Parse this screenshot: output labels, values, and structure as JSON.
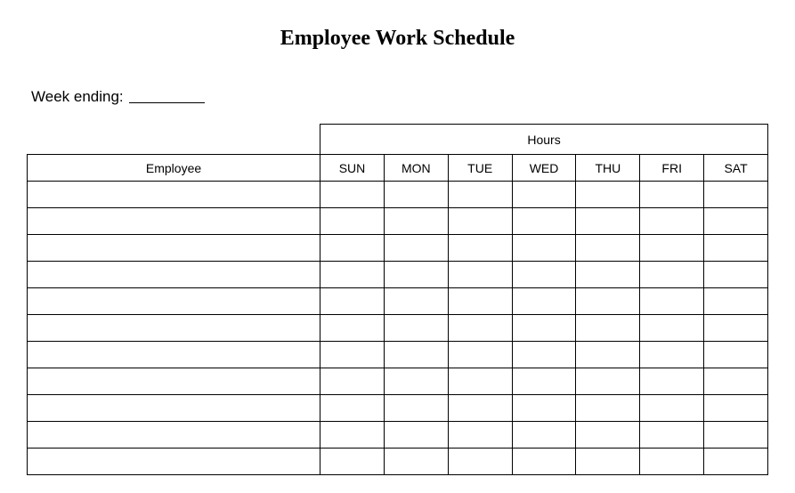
{
  "title": "Employee Work Schedule",
  "week_ending_label": "Week ending:",
  "week_ending_value": "",
  "headers": {
    "employee": "Employee",
    "hours": "Hours",
    "days": [
      "SUN",
      "MON",
      "TUE",
      "WED",
      "THU",
      "FRI",
      "SAT"
    ]
  },
  "rows": [
    {
      "employee": "",
      "sun": "",
      "mon": "",
      "tue": "",
      "wed": "",
      "thu": "",
      "fri": "",
      "sat": ""
    },
    {
      "employee": "",
      "sun": "",
      "mon": "",
      "tue": "",
      "wed": "",
      "thu": "",
      "fri": "",
      "sat": ""
    },
    {
      "employee": "",
      "sun": "",
      "mon": "",
      "tue": "",
      "wed": "",
      "thu": "",
      "fri": "",
      "sat": ""
    },
    {
      "employee": "",
      "sun": "",
      "mon": "",
      "tue": "",
      "wed": "",
      "thu": "",
      "fri": "",
      "sat": ""
    },
    {
      "employee": "",
      "sun": "",
      "mon": "",
      "tue": "",
      "wed": "",
      "thu": "",
      "fri": "",
      "sat": ""
    },
    {
      "employee": "",
      "sun": "",
      "mon": "",
      "tue": "",
      "wed": "",
      "thu": "",
      "fri": "",
      "sat": ""
    },
    {
      "employee": "",
      "sun": "",
      "mon": "",
      "tue": "",
      "wed": "",
      "thu": "",
      "fri": "",
      "sat": ""
    },
    {
      "employee": "",
      "sun": "",
      "mon": "",
      "tue": "",
      "wed": "",
      "thu": "",
      "fri": "",
      "sat": ""
    },
    {
      "employee": "",
      "sun": "",
      "mon": "",
      "tue": "",
      "wed": "",
      "thu": "",
      "fri": "",
      "sat": ""
    },
    {
      "employee": "",
      "sun": "",
      "mon": "",
      "tue": "",
      "wed": "",
      "thu": "",
      "fri": "",
      "sat": ""
    },
    {
      "employee": "",
      "sun": "",
      "mon": "",
      "tue": "",
      "wed": "",
      "thu": "",
      "fri": "",
      "sat": ""
    }
  ]
}
